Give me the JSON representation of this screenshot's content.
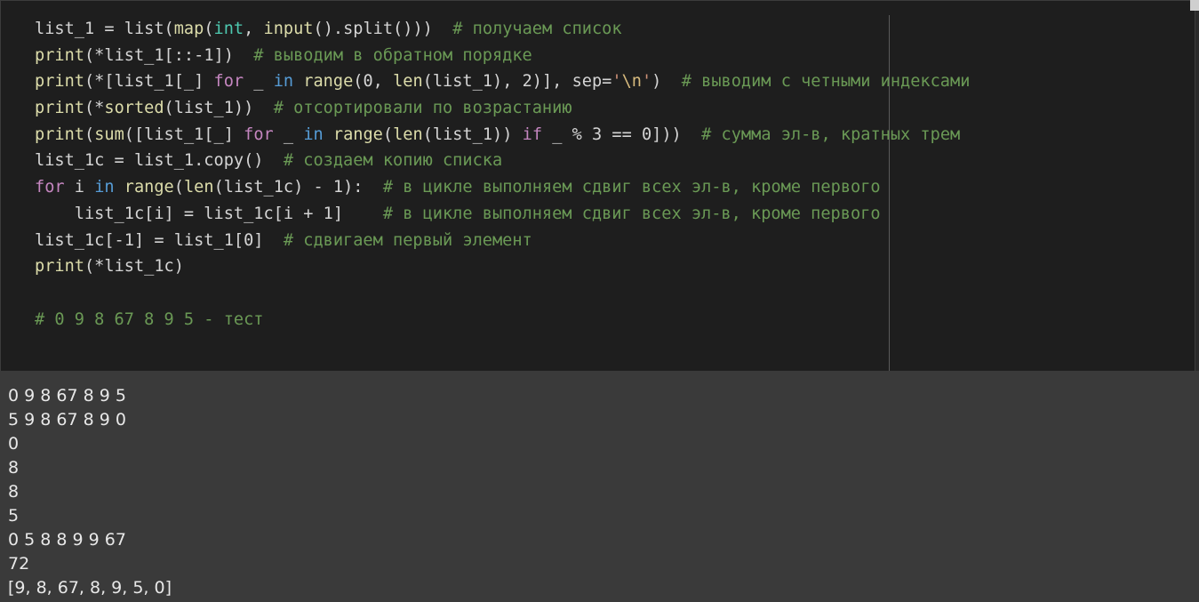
{
  "editor": {
    "lines": [
      {
        "parts": [
          {
            "t": "list_1 = list(",
            "c": ""
          },
          {
            "t": "map",
            "c": "bi"
          },
          {
            "t": "(",
            "c": ""
          },
          {
            "t": "int",
            "c": "ty"
          },
          {
            "t": ", ",
            "c": ""
          },
          {
            "t": "input",
            "c": "bi"
          },
          {
            "t": "().split()))  ",
            "c": ""
          },
          {
            "t": "# получаем список",
            "c": "cm"
          }
        ]
      },
      {
        "parts": [
          {
            "t": "print",
            "c": "bi"
          },
          {
            "t": "(*list_1[::-1])  ",
            "c": ""
          },
          {
            "t": "# выводим в обратном порядке",
            "c": "cm"
          }
        ]
      },
      {
        "parts": [
          {
            "t": "print",
            "c": "bi"
          },
          {
            "t": "(*[list_1[_] ",
            "c": ""
          },
          {
            "t": "for",
            "c": "kw"
          },
          {
            "t": " _ ",
            "c": ""
          },
          {
            "t": "in",
            "c": "kw2"
          },
          {
            "t": " ",
            "c": ""
          },
          {
            "t": "range",
            "c": "bi"
          },
          {
            "t": "(0, ",
            "c": ""
          },
          {
            "t": "len",
            "c": "bi"
          },
          {
            "t": "(list_1), 2)], sep=",
            "c": ""
          },
          {
            "t": "'",
            "c": "str"
          },
          {
            "t": "\\n",
            "c": "esc"
          },
          {
            "t": "'",
            "c": "str"
          },
          {
            "t": ")  ",
            "c": ""
          },
          {
            "t": "# выводим с четными индексами",
            "c": "cm"
          }
        ]
      },
      {
        "parts": [
          {
            "t": "print",
            "c": "bi"
          },
          {
            "t": "(*",
            "c": ""
          },
          {
            "t": "sorted",
            "c": "bi"
          },
          {
            "t": "(list_1))  ",
            "c": ""
          },
          {
            "t": "# отсортировали по возрастанию",
            "c": "cm"
          }
        ]
      },
      {
        "parts": [
          {
            "t": "print",
            "c": "bi"
          },
          {
            "t": "(",
            "c": ""
          },
          {
            "t": "sum",
            "c": "bi"
          },
          {
            "t": "([list_1[_] ",
            "c": ""
          },
          {
            "t": "for",
            "c": "kw"
          },
          {
            "t": " _ ",
            "c": ""
          },
          {
            "t": "in",
            "c": "kw2"
          },
          {
            "t": " ",
            "c": ""
          },
          {
            "t": "range",
            "c": "bi"
          },
          {
            "t": "(",
            "c": ""
          },
          {
            "t": "len",
            "c": "bi"
          },
          {
            "t": "(list_1)) ",
            "c": ""
          },
          {
            "t": "if",
            "c": "kw"
          },
          {
            "t": " _ % 3 == 0]))  ",
            "c": ""
          },
          {
            "t": "# сумма эл-в, кратных трем",
            "c": "cm"
          }
        ]
      },
      {
        "parts": [
          {
            "t": "list_1c = list_1.copy()  ",
            "c": ""
          },
          {
            "t": "# создаем копию списка",
            "c": "cm"
          }
        ]
      },
      {
        "parts": [
          {
            "t": "for",
            "c": "kw"
          },
          {
            "t": " i ",
            "c": ""
          },
          {
            "t": "in",
            "c": "kw2"
          },
          {
            "t": " ",
            "c": ""
          },
          {
            "t": "range",
            "c": "bi"
          },
          {
            "t": "(",
            "c": ""
          },
          {
            "t": "len",
            "c": "bi"
          },
          {
            "t": "(list_1c) - 1):  ",
            "c": ""
          },
          {
            "t": "# в цикле выполняем сдвиг всех эл-в, кроме первого",
            "c": "cm"
          }
        ]
      },
      {
        "parts": [
          {
            "t": "    list_1c[i] = list_1c[i + 1]    ",
            "c": ""
          },
          {
            "t": "# в цикле выполняем сдвиг всех эл-в, кроме первого",
            "c": "cm"
          }
        ]
      },
      {
        "parts": [
          {
            "t": "list_1c[-1] = list_1[0]  ",
            "c": ""
          },
          {
            "t": "# сдвигаем первый элемент",
            "c": "cm"
          }
        ]
      },
      {
        "parts": [
          {
            "t": "print",
            "c": "bi"
          },
          {
            "t": "(*list_1c)",
            "c": ""
          }
        ]
      },
      {
        "parts": []
      },
      {
        "parts": [
          {
            "t": "# 0 9 8 67 8 9 5 - тест",
            "c": "cm"
          }
        ]
      }
    ]
  },
  "console": {
    "output_lines": [
      "0 9 8 67 8 9 5",
      "5 9 8 67 8 9 0",
      "0",
      "8",
      "8",
      "5",
      "0 5 8 8 9 9 67",
      "72",
      "[9, 8, 67, 8, 9, 5, 0]"
    ]
  },
  "colors": {
    "editor_bg": "#1e1e1e",
    "console_bg": "#3a3a3a",
    "keyword": "#c586c0",
    "keyword_in": "#569cd6",
    "builtin": "#dcdcaa",
    "type": "#4ec9b0",
    "string": "#ce9178",
    "comment": "#6a9955"
  }
}
